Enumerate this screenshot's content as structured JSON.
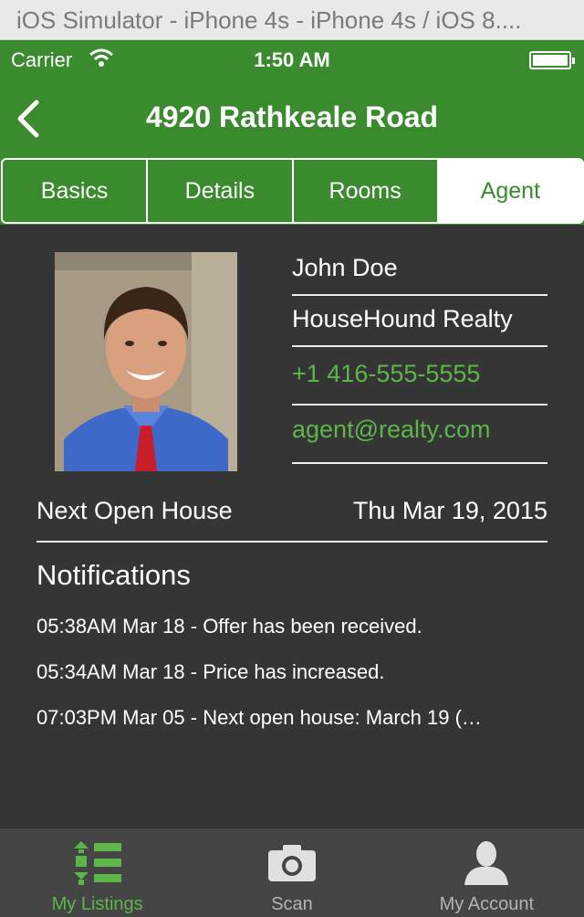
{
  "simulator": {
    "title": "iOS Simulator - iPhone 4s - iPhone 4s / iOS 8...."
  },
  "status_bar": {
    "carrier": "Carrier",
    "time": "1:50 AM",
    "battery_level": 1.0
  },
  "nav": {
    "title": "4920 Rathkeale Road"
  },
  "segments": [
    {
      "label": "Basics"
    },
    {
      "label": "Details"
    },
    {
      "label": "Rooms"
    },
    {
      "label": "Agent"
    }
  ],
  "selected_segment": "Agent",
  "agent": {
    "name": "John Doe",
    "company": "HouseHound Realty",
    "phone": "+1 416-555-5555",
    "email": "agent@realty.com"
  },
  "open_house": {
    "label": "Next Open House",
    "date": "Thu Mar 19, 2015"
  },
  "notifications": {
    "title": "Notifications",
    "items": [
      "05:38AM Mar 18 - Offer has been received.",
      "05:34AM Mar 18 - Price has increased.",
      "07:03PM Mar 05 - Next open house: March 19 (…"
    ]
  },
  "tabbar": [
    {
      "label": "My Listings",
      "icon": "list-icon"
    },
    {
      "label": "Scan",
      "icon": "camera-icon"
    },
    {
      "label": "My Account",
      "icon": "person-icon"
    }
  ],
  "selected_tab": "My Listings",
  "colors": {
    "accent": "#3a8a2e",
    "link": "#5cb64a",
    "background": "#353535",
    "tabbar": "#454545"
  }
}
